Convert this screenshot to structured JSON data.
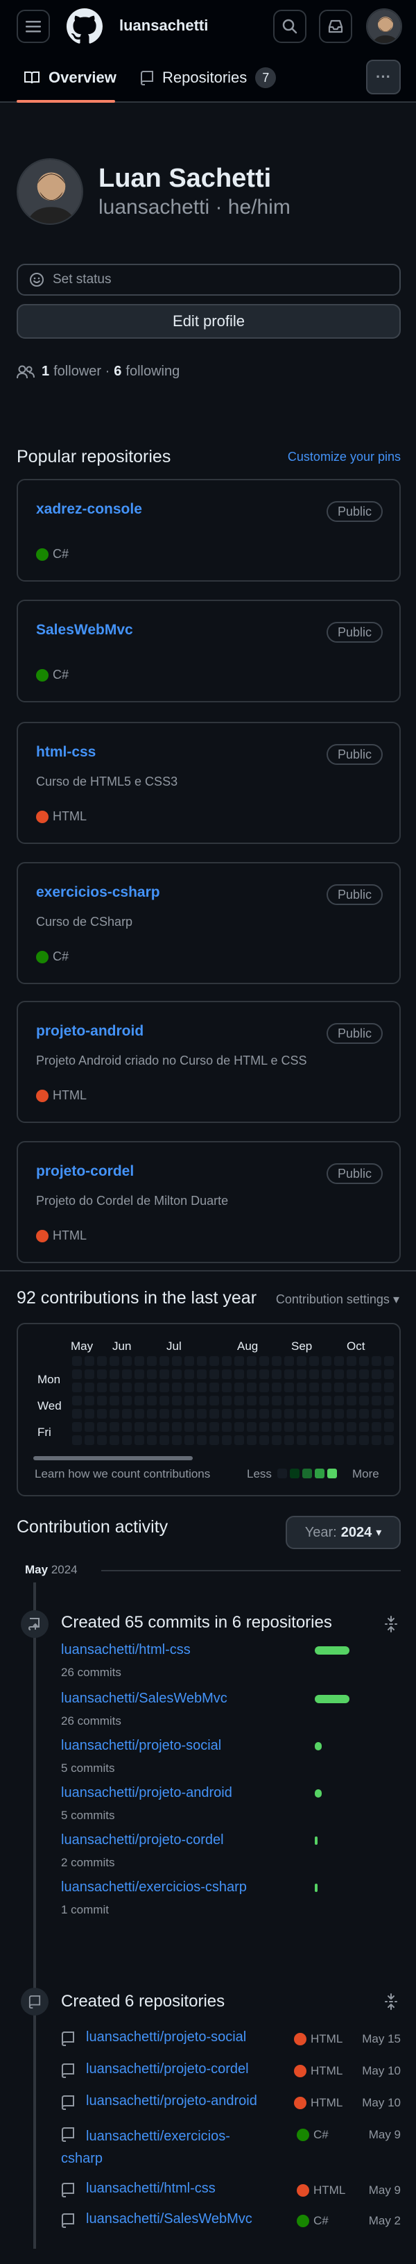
{
  "header": {
    "username": "luansachetti",
    "icons": [
      "menu-icon",
      "github-logo",
      "search-icon",
      "inbox-icon",
      "avatar"
    ]
  },
  "tabs": {
    "overview": "Overview",
    "repositories": "Repositories",
    "repo_count": "7",
    "more": "···"
  },
  "profile": {
    "name": "Luan Sachetti",
    "handle": "luansachetti · he/him",
    "status": "Set status",
    "edit": "Edit profile",
    "followers_count": "1",
    "followers_label": "follower ·",
    "following_count": "6",
    "following_label": "following"
  },
  "popular": {
    "title": "Popular repositories",
    "customize": "Customize your pins",
    "repos": [
      {
        "name": "xadrez-console",
        "badge": "Public",
        "desc": "",
        "lang": "C#",
        "color": "#178600"
      },
      {
        "name": "SalesWebMvc",
        "badge": "Public",
        "desc": "",
        "lang": "C#",
        "color": "#178600"
      },
      {
        "name": "html-css",
        "badge": "Public",
        "desc": "Curso de HTML5 e CSS3",
        "lang": "HTML",
        "color": "#e34c26"
      },
      {
        "name": "exercicios-csharp",
        "badge": "Public",
        "desc": "Curso de CSharp",
        "lang": "C#",
        "color": "#178600"
      },
      {
        "name": "projeto-android",
        "badge": "Public",
        "desc": "Projeto Android criado no Curso de HTML e CSS",
        "lang": "HTML",
        "color": "#e34c26"
      },
      {
        "name": "projeto-cordel",
        "badge": "Public",
        "desc": "Projeto do Cordel de Milton Duarte",
        "lang": "HTML",
        "color": "#e34c26"
      }
    ]
  },
  "contributions": {
    "title": "92 contributions in the last year",
    "settings": "Contribution settings",
    "months": [
      "May",
      "Jun",
      "Jul",
      "Aug",
      "Sep",
      "Oct"
    ],
    "days": [
      "Mon",
      "Wed",
      "Fri"
    ],
    "learn": "Learn how we count contributions",
    "less": "Less",
    "more": "More",
    "legend_colors": [
      "#151b23",
      "#033a16",
      "#196c2e",
      "#2ea043",
      "#56d364"
    ]
  },
  "activity": {
    "title": "Contribution activity",
    "year_label": "Year:",
    "year": "2024",
    "month": "May",
    "month_year": "2024",
    "commits_title": "Created 65 commits in 6 repositories",
    "commits": [
      {
        "repo": "luansachetti/html-css",
        "count": "26 commits",
        "share": 1.0
      },
      {
        "repo": "luansachetti/SalesWebMvc",
        "count": "26 commits",
        "share": 1.0
      },
      {
        "repo": "luansachetti/projeto-social",
        "count": "5 commits",
        "share": 0.19
      },
      {
        "repo": "luansachetti/projeto-android",
        "count": "5 commits",
        "share": 0.19
      },
      {
        "repo": "luansachetti/projeto-cordel",
        "count": "2 commits",
        "share": 0.08
      },
      {
        "repo": "luansachetti/exercicios-csharp",
        "count": "1 commit",
        "share": 0.04
      }
    ],
    "repos_title": "Created 6 repositories",
    "created": [
      {
        "repo": "luansachetti/projeto-social",
        "lang": "HTML",
        "color": "#e34c26",
        "date": "May 15"
      },
      {
        "repo": "luansachetti/projeto-cordel",
        "lang": "HTML",
        "color": "#e34c26",
        "date": "May 10"
      },
      {
        "repo": "luansachetti/projeto-android",
        "lang": "HTML",
        "color": "#e34c26",
        "date": "May 10"
      },
      {
        "repo": "luansachetti/exercicios-csharp",
        "lang": "C#",
        "color": "#178600",
        "date": "May 9"
      },
      {
        "repo": "luansachetti/html-css",
        "lang": "HTML",
        "color": "#e34c26",
        "date": "May 9"
      },
      {
        "repo": "luansachetti/SalesWebMvc",
        "lang": "C#",
        "color": "#178600",
        "date": "May 2"
      }
    ]
  }
}
